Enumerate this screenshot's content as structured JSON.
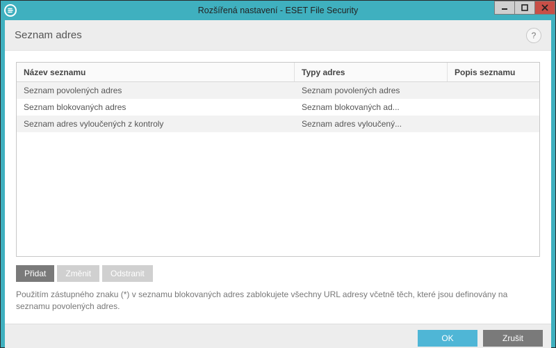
{
  "window": {
    "title": "Rozšířená nastavení - ESET File Security",
    "logo_letter": "e"
  },
  "section": {
    "title": "Seznam adres",
    "help_label": "?"
  },
  "table": {
    "columns": {
      "name": "Název seznamu",
      "types": "Typy adres",
      "desc": "Popis seznamu"
    },
    "rows": [
      {
        "name": "Seznam povolených adres",
        "types": "Seznam povolených adres",
        "desc": ""
      },
      {
        "name": "Seznam blokovaných adres",
        "types": "Seznam blokovaných ad...",
        "desc": ""
      },
      {
        "name": "Seznam adres vyloučených z kontroly",
        "types": "Seznam adres vyloučený...",
        "desc": ""
      }
    ]
  },
  "actions": {
    "add": "Přidat",
    "edit": "Změnit",
    "remove": "Odstranit"
  },
  "hint": "Použitím zástupného znaku (*) v seznamu blokovaných adres zablokujete všechny URL adresy včetně těch, které jsou definovány na seznamu povolených adres.",
  "footer": {
    "ok": "OK",
    "cancel": "Zrušit"
  }
}
